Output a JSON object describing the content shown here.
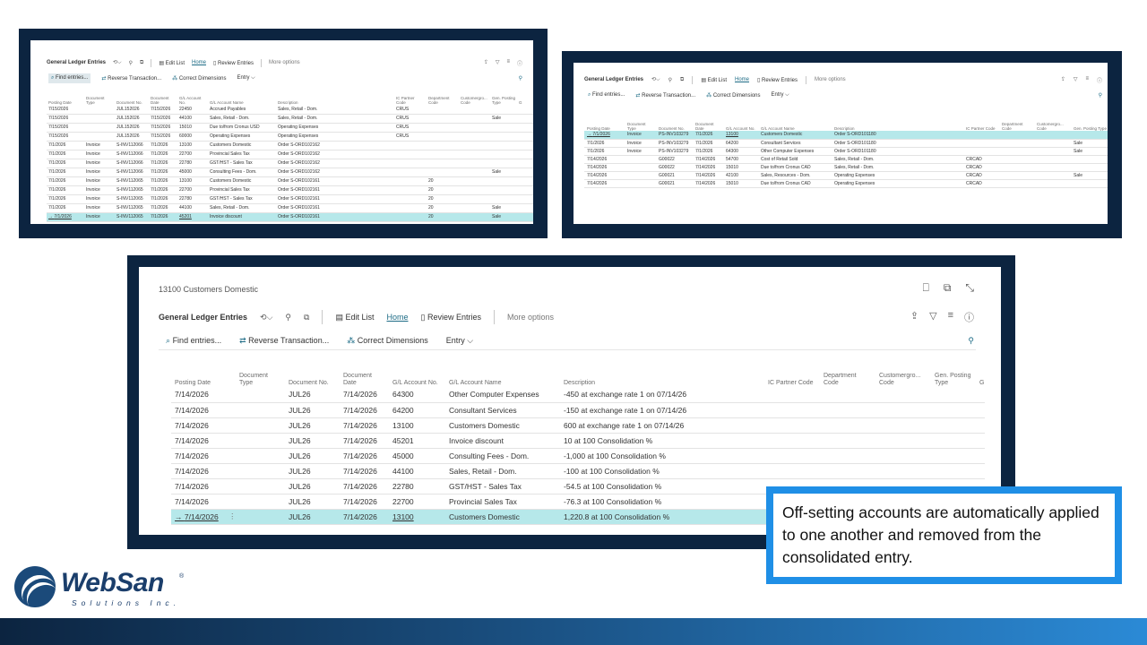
{
  "brand": {
    "name": "WebSan",
    "registered": "®",
    "subtitle": "Solutions Inc.",
    "colors": {
      "navy": "#0c2440",
      "accent_blue": "#1f8fe6",
      "selected_row": "#b6e8ea",
      "link": "#1e6c86"
    }
  },
  "callout": {
    "text": "Off-setting accounts are automatically applied to one another and removed from the consolidated entry."
  },
  "panel1": {
    "page_title": "General Ledger Entries",
    "toolbar": {
      "edit_list": "Edit List",
      "home": "Home",
      "review_entries": "Review Entries",
      "more_options": "More options"
    },
    "actions": {
      "find_entries": "Find entries...",
      "reverse_transaction": "Reverse Transaction...",
      "correct_dimensions": "Correct Dimensions",
      "entry": "Entry"
    },
    "columns": [
      "Posting Date",
      "Document Type",
      "Document No.",
      "Document Date",
      "G/L Account No.",
      "G/L Account Name",
      "Description",
      "IC Partner Code",
      "Department Code",
      "Customergro... Code",
      "Gen. Posting Type",
      "G"
    ],
    "rows": [
      [
        "7/15/2026",
        "",
        "JUL152026",
        "7/15/2026",
        "22450",
        "Accrued Payables",
        "Sales, Retail - Dom.",
        "CRUS",
        "",
        "",
        "",
        ""
      ],
      [
        "7/15/2026",
        "",
        "JUL152026",
        "7/15/2026",
        "44100",
        "Sales, Retail - Dom.",
        "Sales, Retail - Dom.",
        "CRUS",
        "",
        "",
        "Sale",
        ""
      ],
      [
        "7/15/2026",
        "",
        "JUL152026",
        "7/15/2026",
        "15010",
        "Due to/from Cronus USD",
        "Operating Expenses",
        "CRUS",
        "",
        "",
        "",
        ""
      ],
      [
        "7/15/2026",
        "",
        "JUL152026",
        "7/15/2026",
        "60000",
        "Operating Expenses",
        "Operating Expenses",
        "CRUS",
        "",
        "",
        "",
        ""
      ],
      [
        "7/1/2026",
        "Invoice",
        "S-INV112066",
        "7/1/2026",
        "13100",
        "Customers Domestic",
        "Order S-ORD102162",
        "",
        "",
        "",
        "",
        ""
      ],
      [
        "7/1/2026",
        "Invoice",
        "S-INV112066",
        "7/1/2026",
        "22700",
        "Provincial Sales Tax",
        "Order S-ORD102162",
        "",
        "",
        "",
        "",
        ""
      ],
      [
        "7/1/2026",
        "Invoice",
        "S-INV112066",
        "7/1/2026",
        "22780",
        "GST/HST - Sales Tax",
        "Order S-ORD102162",
        "",
        "",
        "",
        "",
        ""
      ],
      [
        "7/1/2026",
        "Invoice",
        "S-INV112066",
        "7/1/2026",
        "45000",
        "Consulting Fees - Dom.",
        "Order S-ORD102162",
        "",
        "",
        "",
        "Sale",
        ""
      ],
      [
        "7/1/2026",
        "Invoice",
        "S-INV112065",
        "7/1/2026",
        "13100",
        "Customers Domestic",
        "Order S-ORD102161",
        "",
        "20",
        "",
        "",
        ""
      ],
      [
        "7/1/2026",
        "Invoice",
        "S-INV112065",
        "7/1/2026",
        "22700",
        "Provincial Sales Tax",
        "Order S-ORD102161",
        "",
        "20",
        "",
        "",
        ""
      ],
      [
        "7/1/2026",
        "Invoice",
        "S-INV112065",
        "7/1/2026",
        "22780",
        "GST/HST - Sales Tax",
        "Order S-ORD102161",
        "",
        "20",
        "",
        "",
        ""
      ],
      [
        "7/1/2026",
        "Invoice",
        "S-INV112065",
        "7/1/2026",
        "44100",
        "Sales, Retail - Dom.",
        "Order S-ORD102161",
        "",
        "20",
        "",
        "Sale",
        ""
      ],
      [
        "7/1/2026",
        "Invoice",
        "S-INV112065",
        "7/1/2026",
        "45201",
        "Invoice discount",
        "Order S-ORD102161",
        "",
        "20",
        "",
        "Sale",
        ""
      ]
    ]
  },
  "panel2": {
    "page_title": "General Ledger Entries",
    "toolbar": {
      "edit_list": "Edit List",
      "home": "Home",
      "review_entries": "Review Entries",
      "more_options": "More options"
    },
    "actions": {
      "find_entries": "Find entries...",
      "reverse_transaction": "Reverse Transaction...",
      "correct_dimensions": "Correct Dimensions",
      "entry": "Entry"
    },
    "columns": [
      "Posting Date",
      "Document Type",
      "Document No.",
      "Document Date",
      "G/L Account No.",
      "G/L Account Name",
      "Description",
      "IC Partner Code",
      "Department Code",
      "Customergro... Code",
      "Gen. Posting Type"
    ],
    "rows": [
      [
        "7/1/2026",
        "Invoice",
        "PS-INV103279",
        "7/1/2026",
        "13100",
        "Customers Domestic",
        "Order S-ORD101180",
        "",
        "",
        "",
        ""
      ],
      [
        "7/1/2026",
        "Invoice",
        "PS-INV103279",
        "7/1/2026",
        "64200",
        "Consultant Services",
        "Order S-ORD101180",
        "",
        "",
        "",
        "Sale"
      ],
      [
        "7/1/2026",
        "Invoice",
        "PS-INV103279",
        "7/1/2026",
        "64300",
        "Other Computer Expenses",
        "Order S-ORD101180",
        "",
        "",
        "",
        "Sale"
      ],
      [
        "7/14/2026",
        "",
        "G00022",
        "7/14/2026",
        "54700",
        "Cost of Retail Sold",
        "Sales, Retail - Dom.",
        "CRCAD",
        "",
        "",
        ""
      ],
      [
        "7/14/2026",
        "",
        "G00022",
        "7/14/2026",
        "15010",
        "Due to/from Cronus CAD",
        "Sales, Retail - Dom.",
        "CRCAD",
        "",
        "",
        ""
      ],
      [
        "7/14/2026",
        "",
        "G00021",
        "7/14/2026",
        "42100",
        "Sales, Resources - Dom.",
        "Operating Expenses",
        "CRCAD",
        "",
        "",
        "Sale"
      ],
      [
        "7/14/2026",
        "",
        "G00021",
        "7/14/2026",
        "15010",
        "Due to/from Cronus CAD",
        "Operating Expenses",
        "CRCAD",
        "",
        "",
        ""
      ]
    ]
  },
  "panel3": {
    "breadcrumb": "13100 Customers Domestic",
    "page_title": "General Ledger Entries",
    "toolbar": {
      "edit_list": "Edit List",
      "home": "Home",
      "review_entries": "Review Entries",
      "more_options": "More options"
    },
    "actions": {
      "find_entries": "Find entries...",
      "reverse_transaction": "Reverse Transaction...",
      "correct_dimensions": "Correct Dimensions",
      "entry": "Entry"
    },
    "columns": [
      "Posting Date",
      "",
      "Document Type",
      "Document No.",
      "Document Date",
      "G/L Account No.",
      "G/L Account Name",
      "Description",
      "IC Partner Code",
      "Department Code",
      "Customergro... Code",
      "Gen. Posting Type",
      "G"
    ],
    "rows": [
      [
        "7/14/2026",
        "",
        "",
        "JUL26",
        "7/14/2026",
        "64300",
        "Other Computer Expenses",
        "-450 at exchange rate 1 on 07/14/26",
        "",
        "",
        "",
        "",
        ""
      ],
      [
        "7/14/2026",
        "",
        "",
        "JUL26",
        "7/14/2026",
        "64200",
        "Consultant Services",
        "-150 at exchange rate 1 on 07/14/26",
        "",
        "",
        "",
        "",
        ""
      ],
      [
        "7/14/2026",
        "",
        "",
        "JUL26",
        "7/14/2026",
        "13100",
        "Customers Domestic",
        "600 at exchange rate 1 on 07/14/26",
        "",
        "",
        "",
        "",
        ""
      ],
      [
        "7/14/2026",
        "",
        "",
        "JUL26",
        "7/14/2026",
        "45201",
        "Invoice discount",
        "10 at 100 Consolidation %",
        "",
        "",
        "",
        "",
        ""
      ],
      [
        "7/14/2026",
        "",
        "",
        "JUL26",
        "7/14/2026",
        "45000",
        "Consulting Fees - Dom.",
        "-1,000 at 100 Consolidation %",
        "",
        "",
        "",
        "",
        ""
      ],
      [
        "7/14/2026",
        "",
        "",
        "JUL26",
        "7/14/2026",
        "44100",
        "Sales, Retail - Dom.",
        "-100 at 100 Consolidation %",
        "",
        "",
        "",
        "",
        ""
      ],
      [
        "7/14/2026",
        "",
        "",
        "JUL26",
        "7/14/2026",
        "22780",
        "GST/HST - Sales Tax",
        "-54.5 at 100 Consolidation %",
        "",
        "",
        "",
        "",
        ""
      ],
      [
        "7/14/2026",
        "",
        "",
        "JUL26",
        "7/14/2026",
        "22700",
        "Provincial Sales Tax",
        "-76.3 at 100 Consolidation %",
        "",
        "",
        "",
        "",
        ""
      ],
      [
        "7/14/2026",
        "⋮",
        "",
        "JUL26",
        "7/14/2026",
        "13100",
        "Customers Domestic",
        "1,220.8 at 100 Consolidation %",
        "",
        "",
        "",
        "",
        ""
      ]
    ]
  },
  "glyphs": {
    "arrow": "→",
    "filter": "▼",
    "chevron": "⌵"
  }
}
